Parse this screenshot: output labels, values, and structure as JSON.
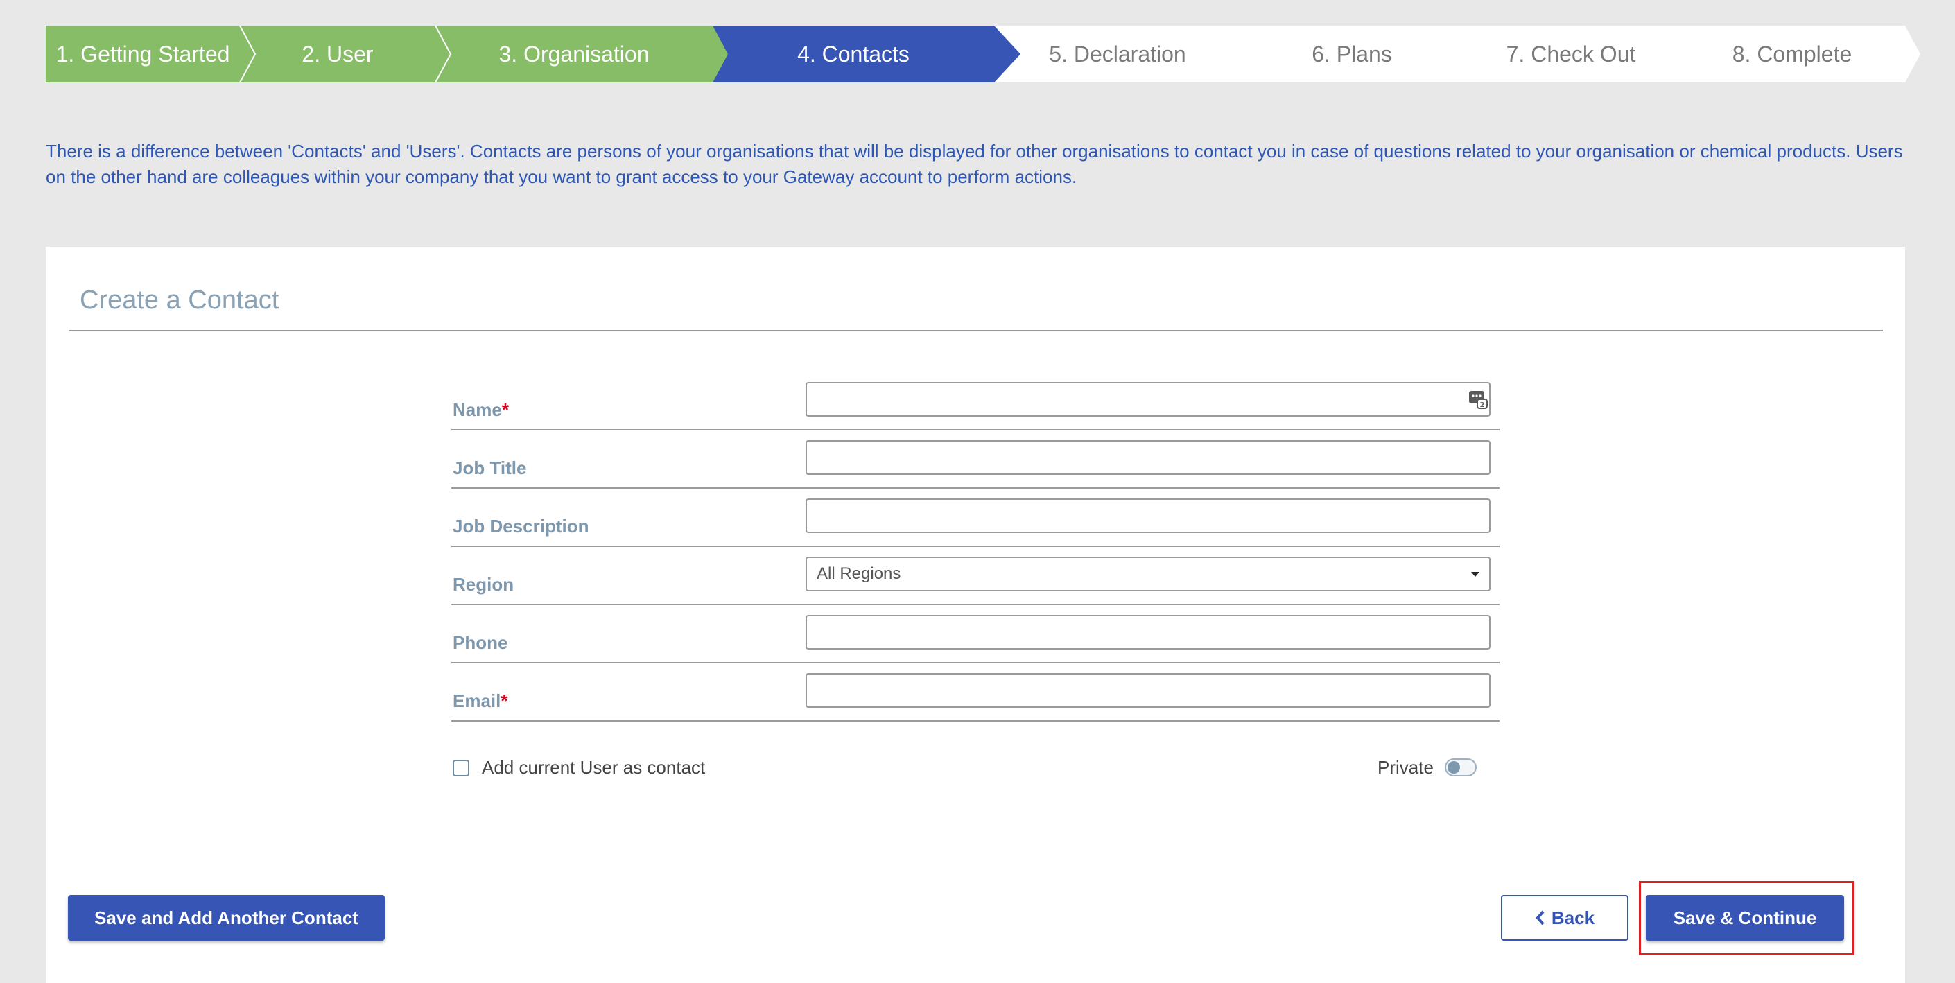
{
  "colors": {
    "step_done": "#86bd66",
    "step_active": "#3655b4",
    "step_todo_text": "#7a7a7a",
    "info_text": "#2e57b5",
    "label": "#7d97ad",
    "required": "#d0021b",
    "primary_button": "#3655b4",
    "highlight_box": "#e02020"
  },
  "wizard": {
    "steps": [
      {
        "label": "1. Getting Started",
        "state": "done"
      },
      {
        "label": "2. User",
        "state": "done"
      },
      {
        "label": "3. Organisation",
        "state": "done"
      },
      {
        "label": "4. Contacts",
        "state": "active"
      },
      {
        "label": "5. Declaration",
        "state": "todo"
      },
      {
        "label": "6. Plans",
        "state": "todo"
      },
      {
        "label": "7. Check Out",
        "state": "todo"
      },
      {
        "label": "8. Complete",
        "state": "todo"
      }
    ]
  },
  "info": {
    "text": "There is a difference between 'Contacts' and 'Users'. Contacts are persons of your organisations that will be displayed for other organisations to contact you in case of questions related to your organisation or chemical products. Users on the other hand are colleagues within your company that you want to grant access to your Gateway account to perform actions."
  },
  "form": {
    "title": "Create a Contact",
    "required_marker": "*",
    "fields": {
      "name": {
        "label": "Name",
        "value": "",
        "icon": "contact-card-icon"
      },
      "job_title": {
        "label": "Job Title",
        "value": ""
      },
      "job_description": {
        "label": "Job Description",
        "value": ""
      },
      "region": {
        "label": "Region",
        "selected": "All Regions"
      },
      "phone": {
        "label": "Phone",
        "value": ""
      },
      "email": {
        "label": "Email",
        "value": ""
      }
    },
    "add_current_user_label": "Add current User as contact",
    "add_current_user_checked": false,
    "private_label": "Private",
    "private_on": false
  },
  "buttons": {
    "save_and_add": "Save and Add Another Contact",
    "back": "Back",
    "back_icon": "chevron-left-icon",
    "save_continue": "Save & Continue"
  }
}
